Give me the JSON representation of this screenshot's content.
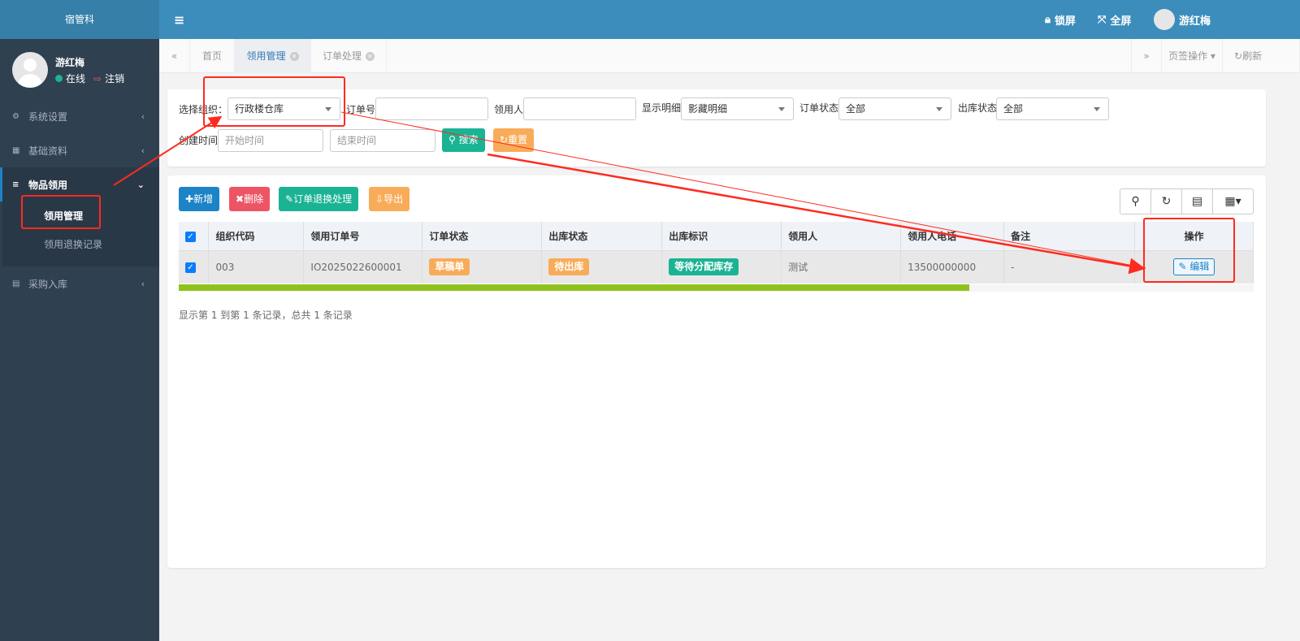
{
  "colors": {
    "sidebar": "#2f4050",
    "header": "#3c8dbc",
    "primary": "#1c84c6",
    "danger": "#ed5565",
    "success": "#1ab394",
    "warning": "#f8ac59",
    "scrollbar": "#8fc21e",
    "annotation": "#ff2a1f"
  },
  "brand": "宿管科",
  "user": {
    "name": "游红梅",
    "status": "在线",
    "logout": "注销"
  },
  "sidebar": {
    "items": [
      {
        "label": "系统设置",
        "icon": "gear-icon"
      },
      {
        "label": "基础资料",
        "icon": "grid-icon"
      },
      {
        "label": "物品领用",
        "icon": "database-icon",
        "children": [
          {
            "label": "领用管理"
          },
          {
            "label": "领用退换记录"
          }
        ]
      },
      {
        "label": "采购入库",
        "icon": "table-icon"
      }
    ]
  },
  "header": {
    "lock": "锁屏",
    "fullscreen": "全屏",
    "user": "游红梅"
  },
  "tabs": {
    "items": [
      {
        "label": "首页"
      },
      {
        "label": "领用管理"
      },
      {
        "label": "订单处理"
      }
    ],
    "tab_ops": "页签操作",
    "refresh": "刷新"
  },
  "search": {
    "org_label": "选择组织：",
    "org_value": "行政楼仓库",
    "order_no_label": "订单号",
    "order_no_value": "",
    "receiver_label": "领用人",
    "receiver_value": "",
    "detail_label": "显示明细",
    "detail_value": "影藏明细",
    "order_status_label": "订单状态",
    "order_status_value": "全部",
    "out_status_label": "出库状态",
    "out_status_value": "全部",
    "create_time_label": "创建时间",
    "start_placeholder": "开始时间",
    "end_placeholder": "结束时间",
    "search_btn": "搜索",
    "reset_btn": "重置"
  },
  "toolbar": {
    "add": "新增",
    "delete": "删除",
    "return": "订单退换处理",
    "export": "导出"
  },
  "table": {
    "columns": [
      "组织代码",
      "领用订单号",
      "订单状态",
      "出库状态",
      "出库标识",
      "领用人",
      "领用人电话",
      "备注",
      "操作"
    ],
    "rows": [
      {
        "checked": true,
        "org_code": "003",
        "order_no": "IO2025022600001",
        "order_status": "草稿单",
        "out_status": "待出库",
        "out_flag": "等待分配库存",
        "receiver": "测试",
        "phone": "13500000000",
        "remark": "-",
        "action": "编辑"
      }
    ],
    "pagination": "显示第 1 到第 1 条记录，总共 1 条记录"
  }
}
